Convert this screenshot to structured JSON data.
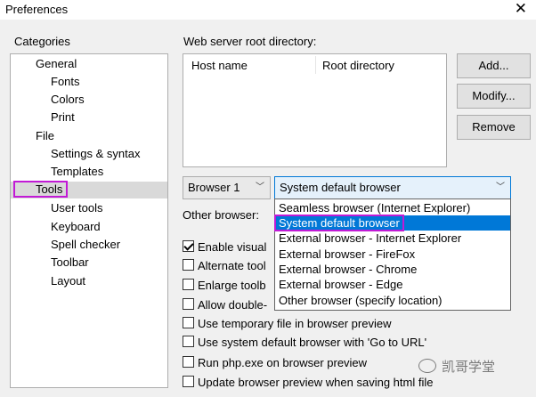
{
  "window": {
    "title": "Preferences",
    "close_symbol": "✕"
  },
  "categories": {
    "label": "Categories",
    "items": [
      {
        "label": "General"
      },
      {
        "label": "Fonts"
      },
      {
        "label": "Colors"
      },
      {
        "label": "Print"
      },
      {
        "label": "File"
      },
      {
        "label": "Settings & syntax"
      },
      {
        "label": "Templates"
      },
      {
        "label": "Tools",
        "selected": true
      },
      {
        "label": "User tools"
      },
      {
        "label": "Keyboard"
      },
      {
        "label": "Spell checker"
      },
      {
        "label": "Toolbar"
      },
      {
        "label": "Layout"
      }
    ]
  },
  "web_server": {
    "label": "Web server root directory:",
    "columns": [
      "Host name",
      "Root directory"
    ]
  },
  "buttons": {
    "add": "Add...",
    "modify": "Modify...",
    "remove": "Remove"
  },
  "browser": {
    "selector_value": "Browser 1",
    "selected_browser": "System default browser",
    "other_browser_label": "Other browser:",
    "options": [
      "Seamless browser (Internet Explorer)",
      "System default browser",
      "External browser - Internet Explorer",
      "External browser - FireFox",
      "External browser - Chrome",
      "External browser - Edge",
      "Other browser (specify location)"
    ],
    "highlighted_index": 1
  },
  "checkboxes": [
    {
      "label": "Enable visual",
      "checked": true
    },
    {
      "label": "Alternate tool",
      "checked": false
    },
    {
      "label": "Enlarge toolb",
      "checked": false
    },
    {
      "label": "Allow double-",
      "checked": false
    },
    {
      "label": "Use temporary file in browser preview",
      "checked": false
    },
    {
      "label": "Use system default browser with 'Go to URL'",
      "checked": false
    },
    {
      "label": "Run php.exe on browser preview",
      "checked": false
    },
    {
      "label": "Update browser preview when saving html file",
      "checked": false
    }
  ],
  "watermark": "凯哥学堂",
  "colors": {
    "highlight": "#0078d7",
    "annotation": "#c21ad6",
    "selected_row": "#d9d9d9"
  }
}
